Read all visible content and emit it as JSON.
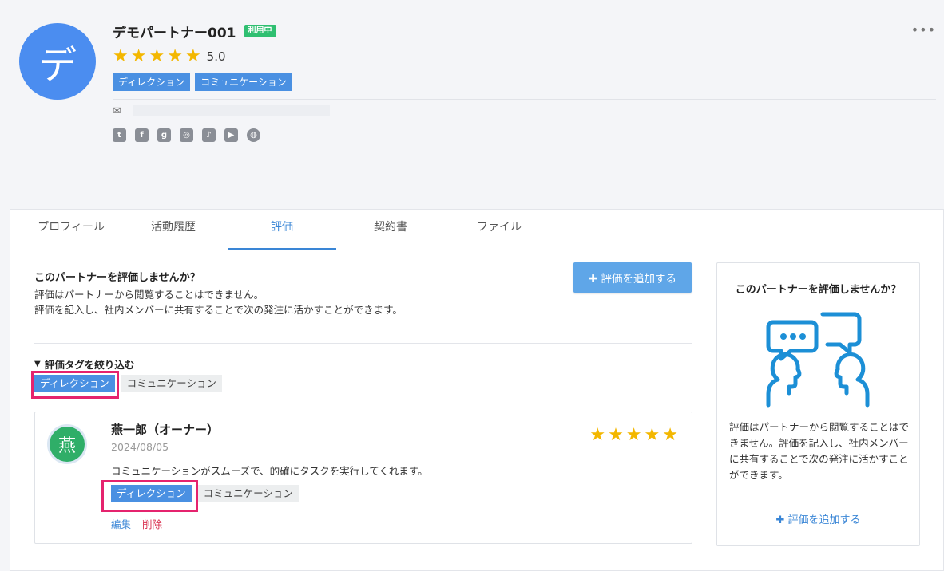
{
  "header": {
    "avatar_letter": "デ",
    "partner_name": "デモパートナー001",
    "status_badge": "利用中",
    "rating_stars": [
      "★",
      "★",
      "★",
      "★",
      "★"
    ],
    "rating_value": "5.0",
    "tags": [
      "ディレクション",
      "コミュニケーション"
    ],
    "mail_icon": "✉",
    "more_icon": "•••",
    "social_icons": [
      {
        "name": "twitter-icon",
        "glyph": "t"
      },
      {
        "name": "facebook-icon",
        "glyph": "f"
      },
      {
        "name": "github-icon",
        "glyph": "g"
      },
      {
        "name": "instagram-icon",
        "glyph": "◎"
      },
      {
        "name": "tiktok-icon",
        "glyph": "♪"
      },
      {
        "name": "youtube-icon",
        "glyph": "▶"
      },
      {
        "name": "globe-icon",
        "glyph": "◍"
      }
    ]
  },
  "tabs": [
    {
      "label": "プロフィール"
    },
    {
      "label": "活動履歴"
    },
    {
      "label": "評価"
    },
    {
      "label": "契約書"
    },
    {
      "label": "ファイル"
    }
  ],
  "active_tab": "評価",
  "invite": {
    "title": "このパートナーを評価しませんか？",
    "line1": "評価はパートナーから閲覧することはできません。",
    "line2": "評価を記入し、社内メンバーに共有することで次の発注に活かすことができます。",
    "add_button": "✚ 評価を追加する"
  },
  "filter": {
    "icon": "▼",
    "label": "評価タグを絞り込む",
    "tags": [
      {
        "label": "ディレクション",
        "selected": true
      },
      {
        "label": "コミュニケーション",
        "selected": false
      }
    ]
  },
  "review": {
    "avatar_letter": "燕",
    "reviewer": "燕一郎（オーナー）",
    "date": "2024/08/05",
    "stars": [
      "★",
      "★",
      "★",
      "★",
      "★"
    ],
    "comment": "コミュニケーションがスムーズで、的確にタスクを実行してくれます。",
    "tags": [
      {
        "label": "ディレクション",
        "selected": true
      },
      {
        "label": "コミュニケーション",
        "selected": false
      }
    ],
    "edit": "編集",
    "delete": "削除"
  },
  "side": {
    "title": "このパートナーを評価しませんか？",
    "text": "評価はパートナーから閲覧することはできません。評価を記入し、社内メンバーに共有することで次の発注に活かすことができます。",
    "add_link": "✚ 評価を追加する"
  },
  "colors": {
    "accent": "#3a86d6",
    "tag_blue": "#4a90e2",
    "status_green": "#2fbf71",
    "star": "#f3b700",
    "highlight": "#e5236e",
    "delete": "#d9304f"
  }
}
